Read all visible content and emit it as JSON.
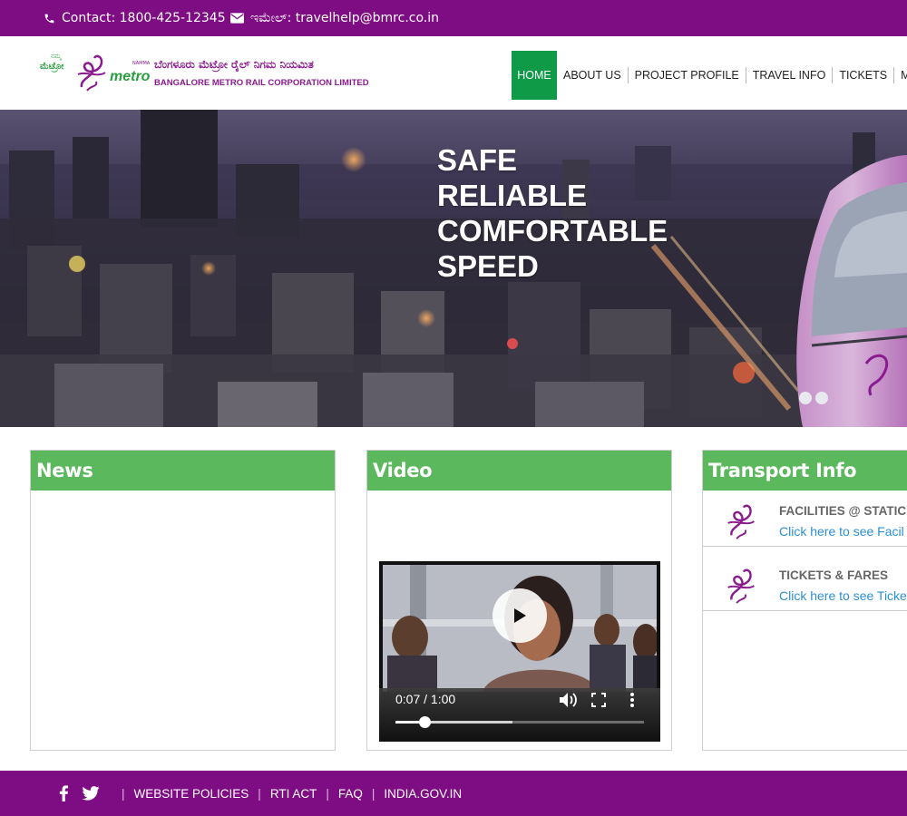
{
  "colors": {
    "brand_purple": "#7e0c82",
    "nav_active": "#0e9a47",
    "panel_header": "#5cb85c",
    "link_blue": "#2d8fcf"
  },
  "topbar": {
    "contact_label": "Contact: 1800-425-12345",
    "email_label": "ಇಮೇಲ್: travelhelp@bmrc.co.in",
    "contact_icon": "phone-icon",
    "email_icon": "envelope-icon"
  },
  "header": {
    "logo": {
      "kannada_name": "ಮೆಟ್ರೋ",
      "namma_kn": "ನಮ್ಮ",
      "metro_word": "metro",
      "namma_en": "NAMMA",
      "title_kn": "ಬೆಂಗಳೂರು ಮೆಟ್ರೋ ರೈಲ್ ನಿಗಮ ನಿಯಮಿತ",
      "title_en": "BANGALORE METRO RAIL CORPORATION LIMITED"
    },
    "nav": [
      "HOME",
      "ABOUT US",
      "PROJECT PROFILE",
      "TRAVEL INFO",
      "TICKETS",
      "METRO"
    ]
  },
  "hero": {
    "lines": [
      "SAFE",
      "RELIABLE",
      "COMFORTABLE",
      "SPEED"
    ]
  },
  "news": {
    "title": "News"
  },
  "video": {
    "title": "Video",
    "time_label": "0:07 / 1:00",
    "progress_fraction": 0.117,
    "buffered_fraction": 0.47
  },
  "transport": {
    "title": "Transport Info",
    "items": [
      {
        "title": "FACILITIES @ STATIC",
        "link": "Click here to see Facil"
      },
      {
        "title": "TICKETS & FARES",
        "link": "Click here to see Ticke"
      }
    ]
  },
  "footer": {
    "social": [
      "facebook-icon",
      "twitter-icon"
    ],
    "links": [
      "WEBSITE POLICIES",
      "RTI ACT",
      "FAQ",
      "INDIA.GOV.IN"
    ]
  }
}
